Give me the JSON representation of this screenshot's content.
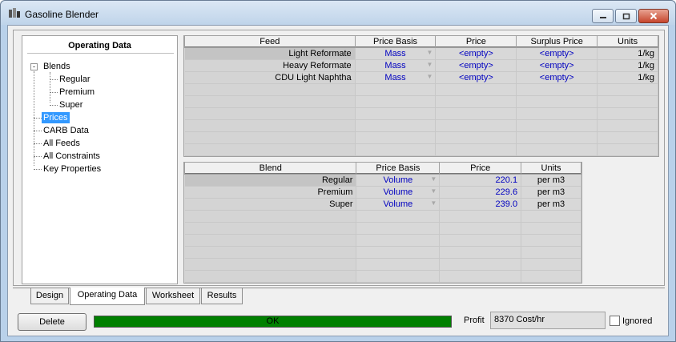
{
  "window": {
    "title": "Gasoline Blender",
    "controls": [
      "minimize-icon",
      "restore-icon",
      "close-icon"
    ]
  },
  "tree": {
    "title": "Operating Data",
    "nodes": {
      "blends": "Blends",
      "regular": "Regular",
      "premium": "Premium",
      "super": "Super",
      "prices": "Prices",
      "carb": "CARB Data",
      "all_feeds": "All Feeds",
      "all_constraints": "All Constraints",
      "key_properties": "Key Properties"
    },
    "selected": "Prices",
    "blends_expander": "-"
  },
  "feed_grid": {
    "columns": [
      "Feed",
      "Price Basis",
      "Price",
      "Surplus Price",
      "Units"
    ],
    "rows": [
      [
        "Light Reformate",
        "Mass",
        "<empty>",
        "<empty>",
        "1/kg"
      ],
      [
        "Heavy Reformate",
        "Mass",
        "<empty>",
        "<empty>",
        "1/kg"
      ],
      [
        "CDU Light Naphtha",
        "Mass",
        "<empty>",
        "<empty>",
        "1/kg"
      ]
    ]
  },
  "blend_grid": {
    "columns": [
      "Blend",
      "Price Basis",
      "Price",
      "Units"
    ],
    "rows": [
      [
        "Regular",
        "Volume",
        "220.1",
        "per m3"
      ],
      [
        "Premium",
        "Volume",
        "229.6",
        "per m3"
      ],
      [
        "Super",
        "Volume",
        "239.0",
        "per m3"
      ]
    ]
  },
  "tabs": [
    "Design",
    "Operating Data",
    "Worksheet",
    "Results"
  ],
  "active_tab": "Operating Data",
  "footer": {
    "delete_label": "Delete",
    "status_text": "OK",
    "status_color": "#008000",
    "profit_label": "Profit",
    "profit_value": "8370 Cost/hr",
    "ignored_label": "Ignored",
    "ignored_checked": false
  }
}
